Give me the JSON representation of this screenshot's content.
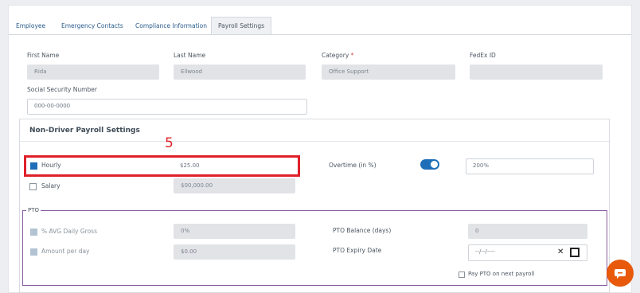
{
  "tabs": [
    "Employee",
    "Emergency Contacts",
    "Compliance Information",
    "Payroll Settings"
  ],
  "fields": {
    "first_name": {
      "label": "First Name",
      "value": "Rida"
    },
    "last_name": {
      "label": "Last Name",
      "value": "Ellwood"
    },
    "category": {
      "label": "Category",
      "required_mark": "*",
      "value": "Office Support"
    },
    "fedex_id": {
      "label": "FedEx ID",
      "value": ""
    },
    "ssn": {
      "label": "Social Security Number",
      "placeholder": "000-00-0000"
    }
  },
  "non_driver": {
    "title": "Non-Driver Payroll Settings",
    "annotation": "5",
    "hourly": {
      "label": "Hourly",
      "value": "$25.00",
      "checked": true
    },
    "salary": {
      "label": "Salary",
      "placeholder": "$00,000.00",
      "checked": false
    },
    "overtime": {
      "label": "Overtime (in %)",
      "value": "200%",
      "enabled": true
    }
  },
  "pto": {
    "legend": "PTO",
    "avg_daily_gross": {
      "label": "% AVG Daily Gross",
      "placeholder": "0%"
    },
    "amount_per_day": {
      "label": "Amount per day",
      "placeholder": "$0.00"
    },
    "balance": {
      "label": "PTO Balance (days)",
      "placeholder": "0"
    },
    "expiry": {
      "label": "PTO Expiry Date",
      "placeholder": "--/--/----",
      "clear_glyph": "✕"
    },
    "pay_next": {
      "label": "Pay PTO on next payroll",
      "checked": false
    }
  },
  "colors": {
    "accent": "#1f6fb8",
    "annotation": "#e0202a",
    "chat": "#e8590c"
  }
}
